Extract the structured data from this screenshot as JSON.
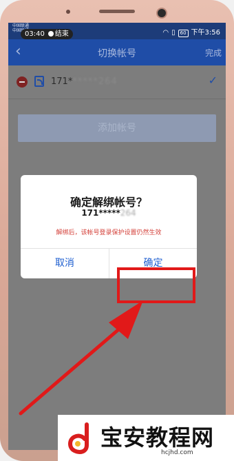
{
  "status_bar": {
    "carrier_lines": [
      "中国联通",
      "中国联通"
    ],
    "time_left": "03:40",
    "end_label": "结束",
    "battery": "60",
    "time_right": "下午3:56"
  },
  "nav": {
    "back_icon": "chevron-left-icon",
    "title": "切换帐号",
    "done_label": "完成"
  },
  "account": {
    "number_visible": "171*",
    "number_masked": "*****264",
    "selected": true
  },
  "add_button": {
    "label": "添加帐号"
  },
  "dialog": {
    "title": "确定解绑帐号？",
    "number_visible": "171*****",
    "number_masked": "264",
    "warning": "解绑后，该帐号登录保护设置仍然生效",
    "cancel_label": "取消",
    "confirm_label": "确定"
  },
  "watermark": {
    "title": "宝安教程网",
    "url": "hcjhd.com"
  },
  "colors": {
    "nav_blue": "#1f4da7",
    "accent_red": "#e11919",
    "dialog_link": "#1f5fd0",
    "warning_red": "#d4423b"
  }
}
